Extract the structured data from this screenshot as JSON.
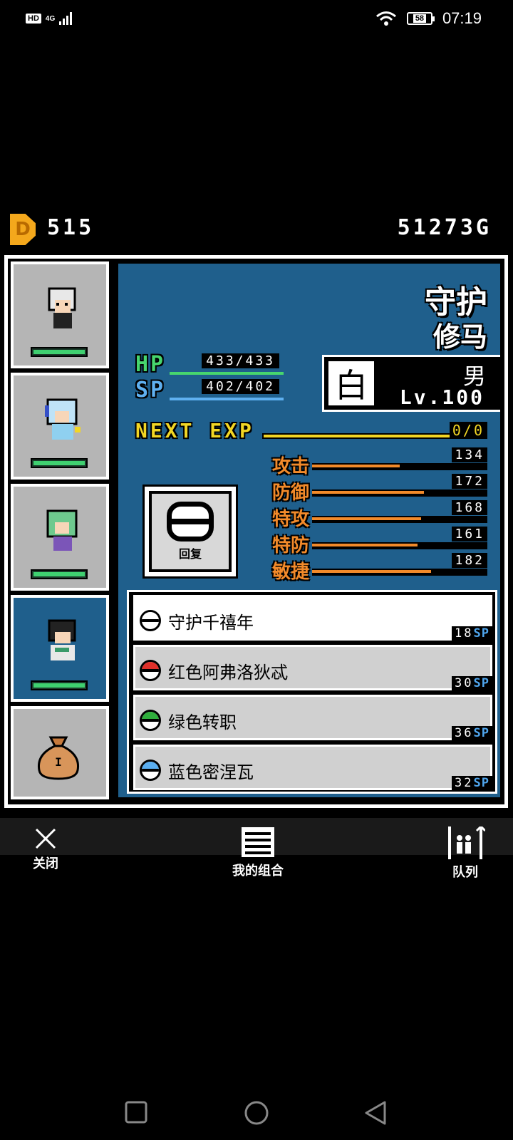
{
  "status_bar": {
    "hd": "HD",
    "network": "4G",
    "battery": "58",
    "time": "07:19"
  },
  "currency": {
    "coins": "515",
    "gold": "51273G"
  },
  "character": {
    "class": "守护",
    "name": "修马",
    "hp_label": "HP",
    "hp": "433/433",
    "sp_label": "SP",
    "sp": "402/402",
    "element_icon": "白",
    "gender": "男",
    "level": "Lv.100",
    "next_exp_label": "NEXT EXP",
    "next_exp": "0/0",
    "item_label": "回复",
    "attributes": [
      {
        "name": "攻击",
        "value": "134",
        "fill_fraction": 0.5
      },
      {
        "name": "防御",
        "value": "172",
        "fill_fraction": 0.64
      },
      {
        "name": "特攻",
        "value": "168",
        "fill_fraction": 0.62
      },
      {
        "name": "特防",
        "value": "161",
        "fill_fraction": 0.6
      },
      {
        "name": "敏捷",
        "value": "182",
        "fill_fraction": 0.68
      }
    ]
  },
  "skills": [
    {
      "name": "守护千禧年",
      "cost": "18",
      "unit": "SP",
      "ball_color": "#ffffff"
    },
    {
      "name": "红色阿弗洛狄忒",
      "cost": "30",
      "unit": "SP",
      "ball_color": "#e0302a"
    },
    {
      "name": "绿色转职",
      "cost": "36",
      "unit": "SP",
      "ball_color": "#2fae3c"
    },
    {
      "name": "蓝色密涅瓦",
      "cost": "32",
      "unit": "SP",
      "ball_color": "#5aaef0"
    }
  ],
  "bottom_bar": {
    "close": "关闭",
    "my_combo": "我的组合",
    "queue": "队列"
  },
  "colors": {
    "panel_blue": "#1f5f8c",
    "hp_green": "#47d66e",
    "sp_blue": "#5fb0f0",
    "exp_yellow": "#f2d624",
    "attr_orange": "#f28a2a"
  }
}
